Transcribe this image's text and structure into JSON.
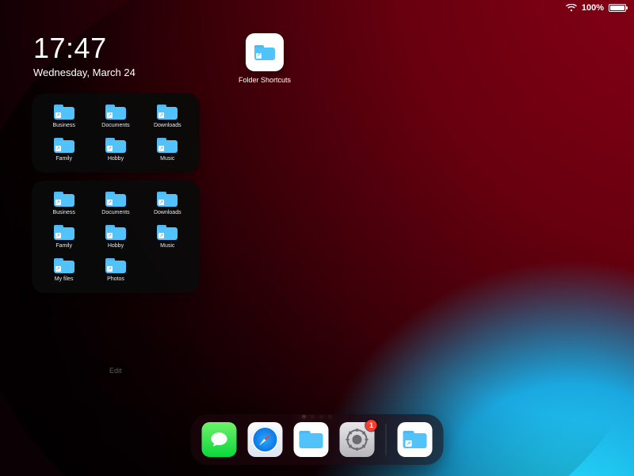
{
  "status": {
    "battery_text": "100%"
  },
  "clock": {
    "time": "17:47",
    "date": "Wednesday, March 24"
  },
  "homescreen": {
    "apps": [
      {
        "label": "Folder Shortcuts"
      }
    ],
    "edit_label": "Edit",
    "page_count": 4,
    "active_page": 0
  },
  "widgets": [
    {
      "items": [
        {
          "label": "Business"
        },
        {
          "label": "Documents"
        },
        {
          "label": "Downloads"
        },
        {
          "label": "Family"
        },
        {
          "label": "Hobby"
        },
        {
          "label": "Music"
        }
      ]
    },
    {
      "items": [
        {
          "label": "Business"
        },
        {
          "label": "Documents"
        },
        {
          "label": "Downloads"
        },
        {
          "label": "Family"
        },
        {
          "label": "Hobby"
        },
        {
          "label": "Music"
        },
        {
          "label": "My files"
        },
        {
          "label": "Photos"
        }
      ]
    }
  ],
  "dock": {
    "left": [
      {
        "name": "messages"
      },
      {
        "name": "safari"
      },
      {
        "name": "files"
      },
      {
        "name": "settings",
        "badge": "1"
      }
    ],
    "right": [
      {
        "name": "folder-shortcuts"
      }
    ]
  },
  "colors": {
    "folder": "#52c2fb",
    "folder_tab": "#4fb8f0",
    "badge": "#ff3b30"
  }
}
